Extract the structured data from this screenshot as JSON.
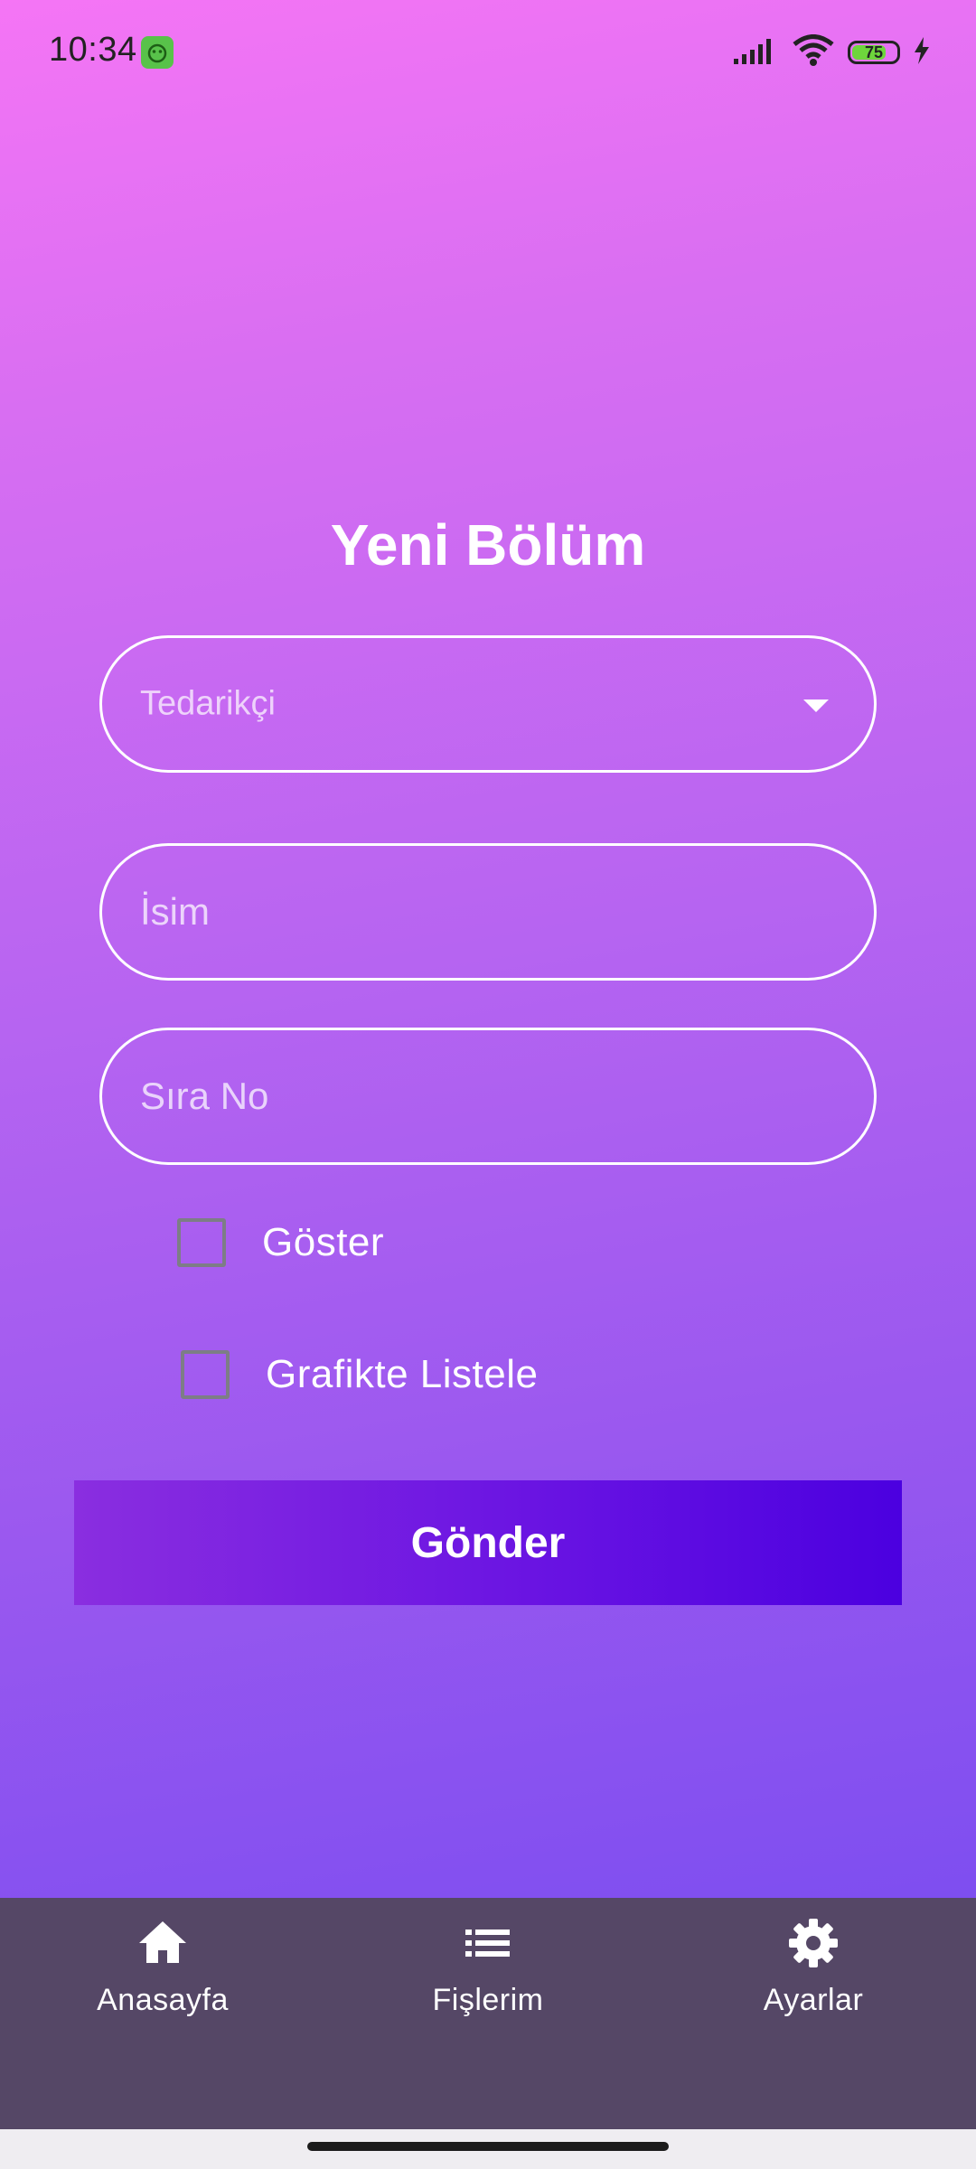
{
  "status_bar": {
    "time": "10:34",
    "battery_level": "75",
    "icons": [
      "app-notification-icon",
      "signal-icon",
      "wifi-icon",
      "battery-icon",
      "charging-icon"
    ]
  },
  "form": {
    "title": "Yeni Bölüm",
    "supplier_dropdown": {
      "placeholder": "Tedarikçi",
      "icon": "caret-down-icon"
    },
    "name_field": {
      "placeholder": "İsim",
      "value": ""
    },
    "order_field": {
      "placeholder": "Sıra No",
      "value": ""
    },
    "checkboxes": [
      {
        "label": "Göster",
        "checked": false
      },
      {
        "label": "Grafikte Listele",
        "checked": false
      }
    ],
    "submit_label": "Gönder"
  },
  "bottom_nav": {
    "items": [
      {
        "label": "Anasayfa",
        "icon": "home-icon"
      },
      {
        "label": "Fişlerim",
        "icon": "list-icon"
      },
      {
        "label": "Ayarlar",
        "icon": "gear-icon"
      }
    ]
  },
  "colors": {
    "background_top": "#f575f5",
    "background_bottom": "#7e4ef0",
    "button_start": "#8a2ee0",
    "button_end": "#4b00e0",
    "nav_background": "#554766"
  }
}
